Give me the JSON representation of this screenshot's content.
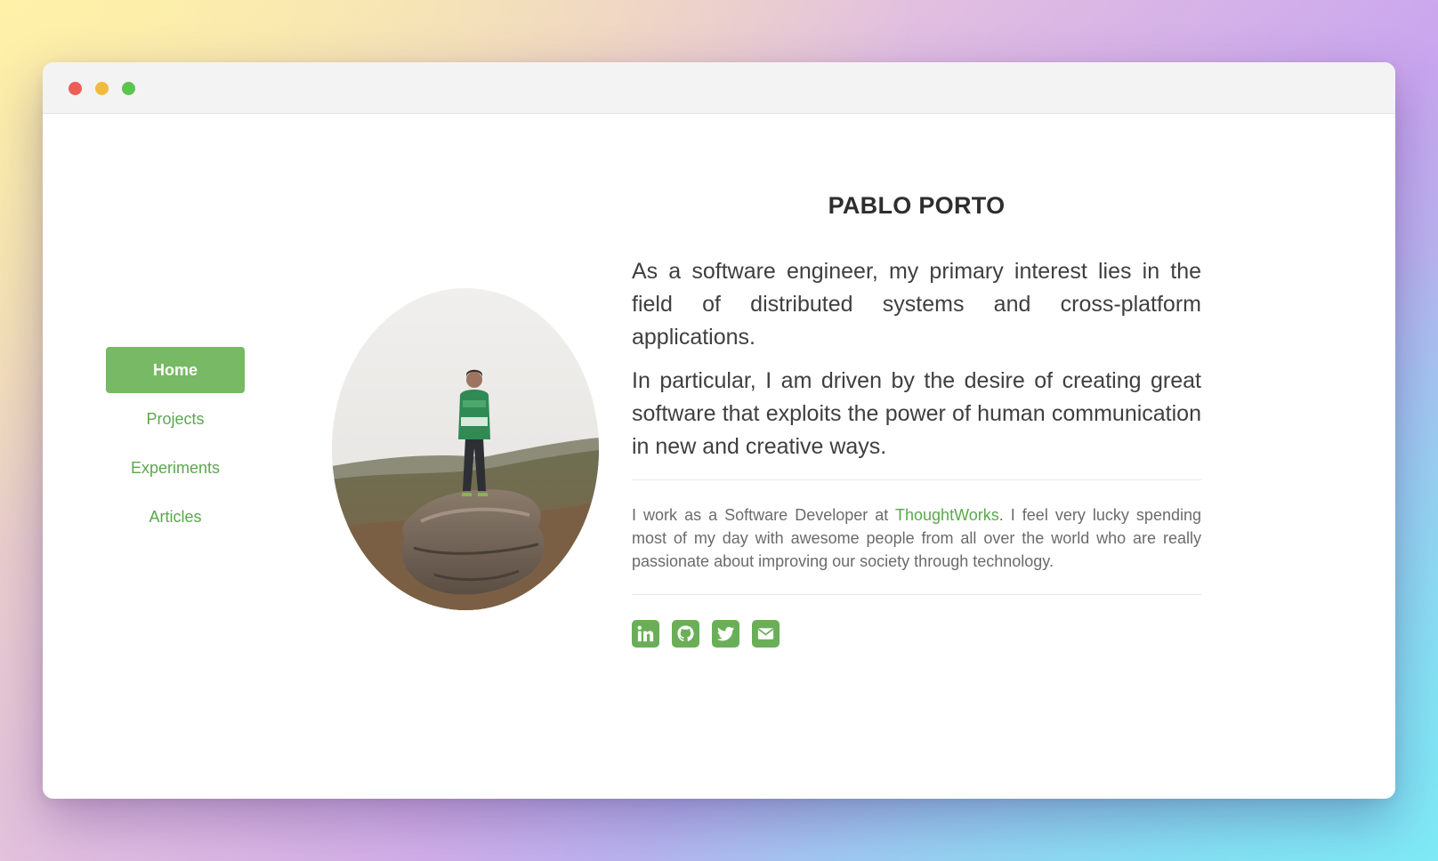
{
  "nav": {
    "items": [
      {
        "label": "Home",
        "active": true
      },
      {
        "label": "Projects",
        "active": false
      },
      {
        "label": "Experiments",
        "active": false
      },
      {
        "label": "Articles",
        "active": false
      }
    ]
  },
  "profile": {
    "name": "PABLO PORTO",
    "intro_1": "As a software engineer, my primary interest lies in the field of distributed systems and cross-platform applications.",
    "intro_2": "In particular, I am driven by the desire of creating great software that exploits the power of human communication in new and creative ways.",
    "work_before": "I work as a Software Developer at ",
    "work_link": "ThoughtWorks",
    "work_after": ". I feel very lucky spending most of my day with awesome people from all over the world who are really passionate about improving our society through technology."
  },
  "social": {
    "icons": [
      "linkedin-icon",
      "github-icon",
      "twitter-icon",
      "email-icon"
    ]
  },
  "colors": {
    "accent": "#77b964",
    "link": "#5aa84d",
    "window_close": "#ec5f57",
    "window_minimize": "#f2bb40",
    "window_zoom": "#5bc44f"
  }
}
